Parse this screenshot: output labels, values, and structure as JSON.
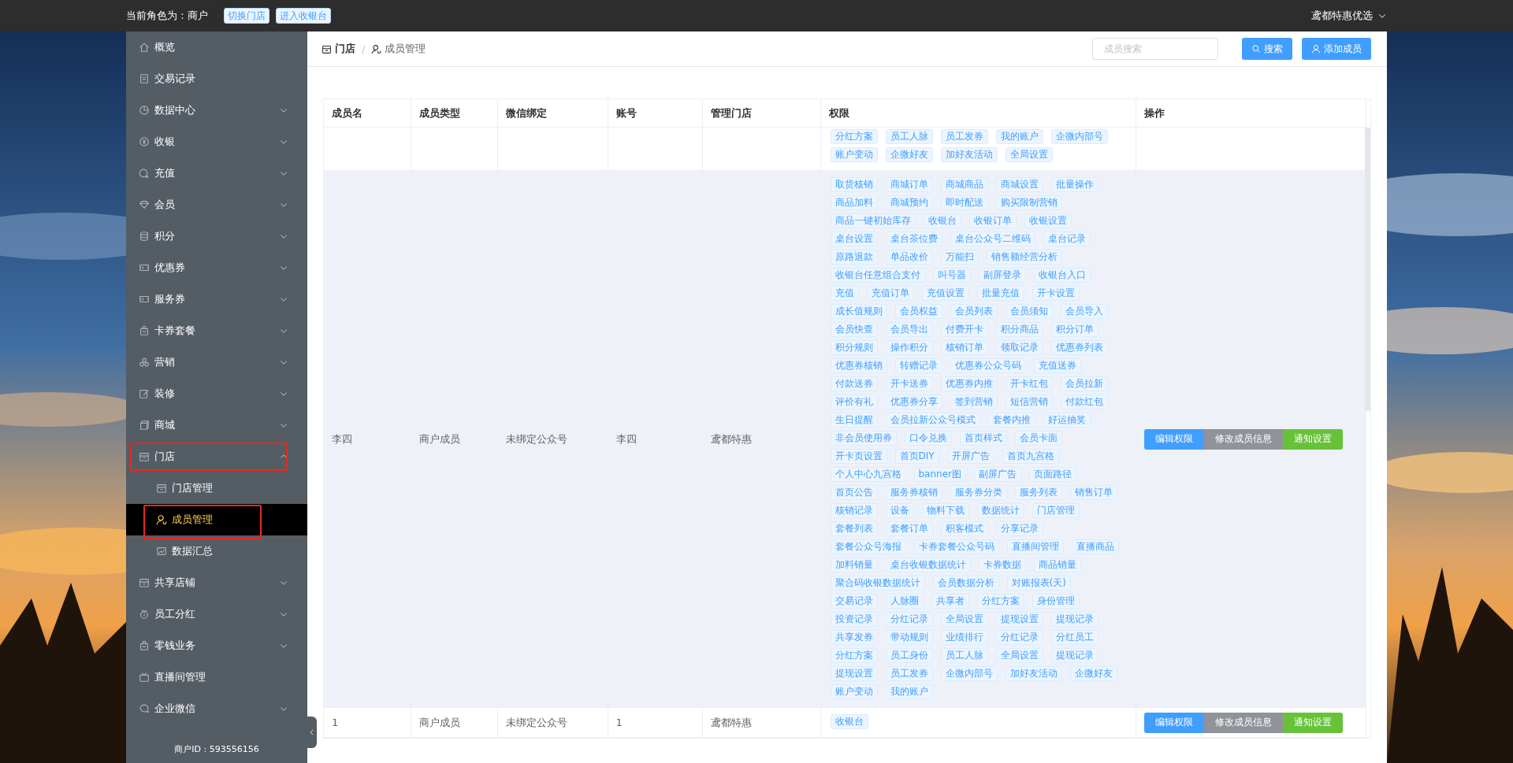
{
  "top_bar": {
    "role": "当前角色为 : 商户",
    "buttons": [
      "切换门店",
      "进入收银台"
    ],
    "account": "鸢都特惠优选"
  },
  "sidebar": {
    "items": [
      {
        "label": "概览",
        "selected": false,
        "outlined": false
      },
      {
        "label": "交易记录",
        "selected": false,
        "outlined": false
      },
      {
        "label": "数据中心",
        "selected": false,
        "outlined": false,
        "expanded": false
      },
      {
        "label": "收银",
        "selected": false,
        "outlined": false,
        "expanded": false
      },
      {
        "label": "充值",
        "selected": false,
        "outlined": false,
        "expanded": false
      },
      {
        "label": "会员",
        "selected": false,
        "outlined": false,
        "expanded": false
      },
      {
        "label": "积分",
        "selected": false,
        "outlined": false,
        "expanded": false
      },
      {
        "label": "优惠券",
        "selected": false,
        "outlined": false,
        "expanded": false
      },
      {
        "label": "服务券",
        "selected": false,
        "outlined": false,
        "expanded": false
      },
      {
        "label": "卡券套餐",
        "selected": false,
        "outlined": false,
        "expanded": false
      },
      {
        "label": "营销",
        "selected": false,
        "outlined": false,
        "expanded": false
      },
      {
        "label": "装修",
        "selected": false,
        "outlined": false,
        "expanded": false
      },
      {
        "label": "商城",
        "selected": false,
        "outlined": false,
        "expanded": false
      },
      {
        "label": "门店",
        "selected": false,
        "outlined": true,
        "expanded": true,
        "children": [
          {
            "label": "门店管理",
            "selected": false,
            "outlined": false
          },
          {
            "label": "成员管理",
            "selected": true,
            "outlined": true
          },
          {
            "label": "数据汇总",
            "selected": false,
            "outlined": false
          }
        ]
      },
      {
        "label": "共享店铺",
        "selected": false,
        "outlined": false,
        "expanded": false
      },
      {
        "label": "员工分红",
        "selected": false,
        "outlined": false,
        "expanded": false
      },
      {
        "label": "零钱业务",
        "selected": false,
        "outlined": false,
        "expanded": false
      },
      {
        "label": "直播间管理",
        "selected": false,
        "outlined": false
      },
      {
        "label": "企业微信",
        "selected": false,
        "outlined": false,
        "expanded": false
      }
    ],
    "merchant_id": "商户ID : 593556156"
  },
  "breadcrumb": [
    "门店",
    "成员管理"
  ],
  "breadcrumb_separator": "/",
  "search": {
    "placeholder": "成员搜索",
    "button": "搜索"
  },
  "add_button": "添加成员",
  "table": {
    "columns": [
      "成员名",
      "成员类型",
      "微信绑定",
      "账号",
      "管理门店",
      "权限",
      "操作"
    ],
    "rows": [
      {
        "cells": [],
        "striped": false,
        "permissions": [
          "分红方案",
          "员工人脉",
          "员工发券",
          "我的账户",
          "企微内部号",
          "账户变动",
          "企微好友",
          "加好友活动",
          "全局设置"
        ],
        "actions": []
      },
      {
        "cells": [
          "李四",
          "商户成员",
          "未绑定公众号",
          "李四",
          "鸢都特惠"
        ],
        "striped": true,
        "permissions": [
          "取货核销",
          "商城订单",
          "商城商品",
          "商城设置",
          "批量操作",
          "商品加料",
          "商城预约",
          "即时配送",
          "购买限制营销",
          "商品一键初始库存",
          "收银台",
          "收银订单",
          "收银设置",
          "桌台设置",
          "桌台茶位费",
          "桌台公众号二维码",
          "桌台记录",
          "原路退款",
          "单品改价",
          "万能扫",
          "销售额经营分析",
          "收银台任意组合支付",
          "叫号器",
          "副屏登录",
          "收银台入口",
          "充值",
          "充值订单",
          "充值设置",
          "批量充值",
          "开卡设置",
          "成长值规则",
          "会员权益",
          "会员列表",
          "会员须知",
          "会员导入",
          "会员快查",
          "会员导出",
          "付费开卡",
          "积分商品",
          "积分订单",
          "积分规则",
          "操作积分",
          "核销订单",
          "领取记录",
          "优惠券列表",
          "优惠券核销",
          "转赠记录",
          "优惠券公众号码",
          "充值送券",
          "付款送券",
          "开卡送券",
          "优惠券内推",
          "开卡红包",
          "会员拉新",
          "评价有礼",
          "优惠券分享",
          "签到营销",
          "短信营销",
          "付款红包",
          "生日提醒",
          "会员拉新公众号模式",
          "套餐内推",
          "好运抽奖",
          "非会员使用券",
          "口令兑换",
          "首页样式",
          "会员卡面",
          "开卡页设置",
          "首页DIY",
          "开屏广告",
          "首页九宫格",
          "个人中心九宫格",
          "banner图",
          "副屏广告",
          "页面路径",
          "首页公告",
          "服务券核销",
          "服务券分类",
          "服务列表",
          "销售订单",
          "核销记录",
          "设备",
          "物料下载",
          "数据统计",
          "门店管理",
          "套餐列表",
          "套餐订单",
          "积客模式",
          "分享记录",
          "套餐公众号海报",
          "卡券套餐公众号码",
          "直播间管理",
          "直播商品",
          "加料销量",
          "桌台收银数据统计",
          "卡券数据",
          "商品销量",
          "聚合码收银数据统计",
          "会员数据分析",
          "对账报表(天)",
          "交易记录",
          "人脉圈",
          "共享者",
          "分红方案",
          "身份管理",
          "投资记录",
          "分红记录",
          "全局设置",
          "提现设置",
          "提现记录",
          "共享发券",
          "带动规则",
          "业绩排行",
          "分红记录",
          "分红员工",
          "分红方案",
          "员工身份",
          "员工人脉",
          "全局设置",
          "提现记录",
          "提现设置",
          "员工发券",
          "企微内部号",
          "加好友活动",
          "企微好友",
          "账户变动",
          "我的账户"
        ],
        "actions": [
          {
            "label": "编辑权限",
            "kind": "primary"
          },
          {
            "label": "修改成员信息",
            "kind": "info"
          },
          {
            "label": "通知设置",
            "kind": "success"
          }
        ]
      },
      {
        "cells": [
          "1",
          "商户成员",
          "未绑定公众号",
          "1",
          "鸢都特惠"
        ],
        "striped": false,
        "permissions": [
          "收银台"
        ],
        "actions": [
          {
            "label": "编辑权限",
            "kind": "primary"
          },
          {
            "label": "修改成员信息",
            "kind": "info"
          },
          {
            "label": "通知设置",
            "kind": "success"
          }
        ]
      }
    ]
  }
}
